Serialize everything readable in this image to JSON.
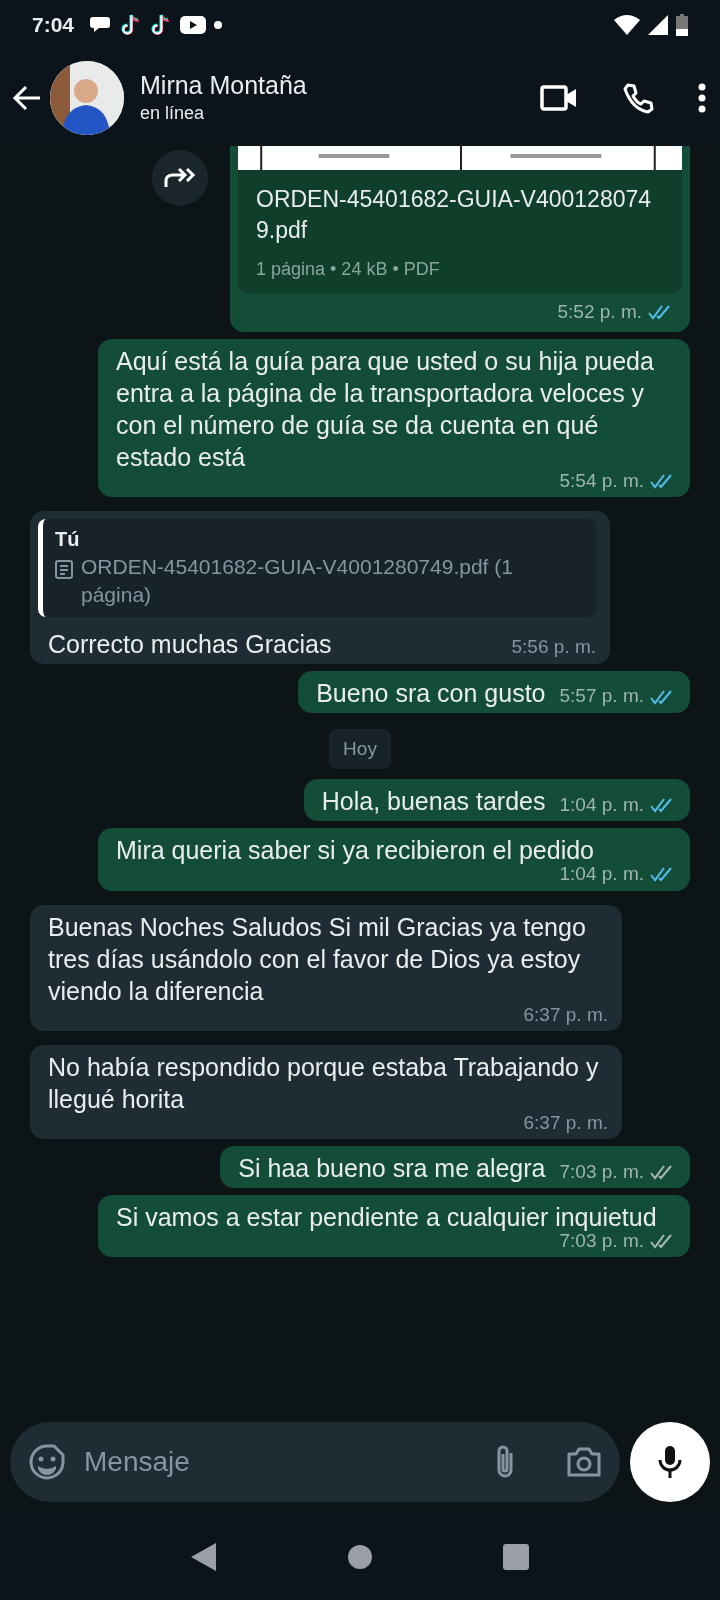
{
  "status_bar": {
    "time": "7:04"
  },
  "header": {
    "name": "Mirna Montaña",
    "status": "en línea"
  },
  "messages": [
    {
      "kind": "document",
      "outgoing": true,
      "file_name": "ORDEN-45401682-GUIA-V4001280749.pdf",
      "meta": "1 página • 24 kB • PDF",
      "time": "5:52 p. m.",
      "read": true
    },
    {
      "kind": "text",
      "outgoing": true,
      "text": "Aquí está la guía para que usted o su hija pueda entra  a la página de la transportadora veloces y con el número de guía se da cuenta en qué estado está",
      "time": "5:54 p. m.",
      "read": true
    },
    {
      "kind": "reply",
      "outgoing": false,
      "quote_author": "Tú",
      "quote_text": "ORDEN-45401682-GUIA-V4001280749.pdf (1 página)",
      "text": "Correcto muchas Gracias",
      "time": "5:56 p. m."
    },
    {
      "kind": "text",
      "outgoing": true,
      "text": "Bueno sra con gusto",
      "time": "5:57 p. m.",
      "read": true
    },
    {
      "kind": "day",
      "text": "Hoy"
    },
    {
      "kind": "text",
      "outgoing": true,
      "text": "Hola, buenas tardes",
      "time": "1:04 p. m.",
      "read": true
    },
    {
      "kind": "text",
      "outgoing": true,
      "text": "Mira queria saber si ya recibieron el pedido",
      "time": "1:04 p. m.",
      "read": true
    },
    {
      "kind": "text",
      "outgoing": false,
      "text": "Buenas Noches Saludos Si mil Gracias ya tengo tres días usándolo con el favor de Dios ya estoy viendo la diferencia",
      "time": "6:37 p. m."
    },
    {
      "kind": "text",
      "outgoing": false,
      "text": "No había respondido porque estaba Trabajando y llegué horita",
      "time": "6:37 p. m."
    },
    {
      "kind": "text",
      "outgoing": true,
      "text": "Si haa bueno sra me alegra",
      "time": "7:03 p. m.",
      "read": false
    },
    {
      "kind": "text",
      "outgoing": true,
      "text": "Si vamos a estar pendiente a cualquier inquietud",
      "time": "7:03 p. m.",
      "read": false
    }
  ],
  "composer": {
    "placeholder": "Mensaje"
  }
}
